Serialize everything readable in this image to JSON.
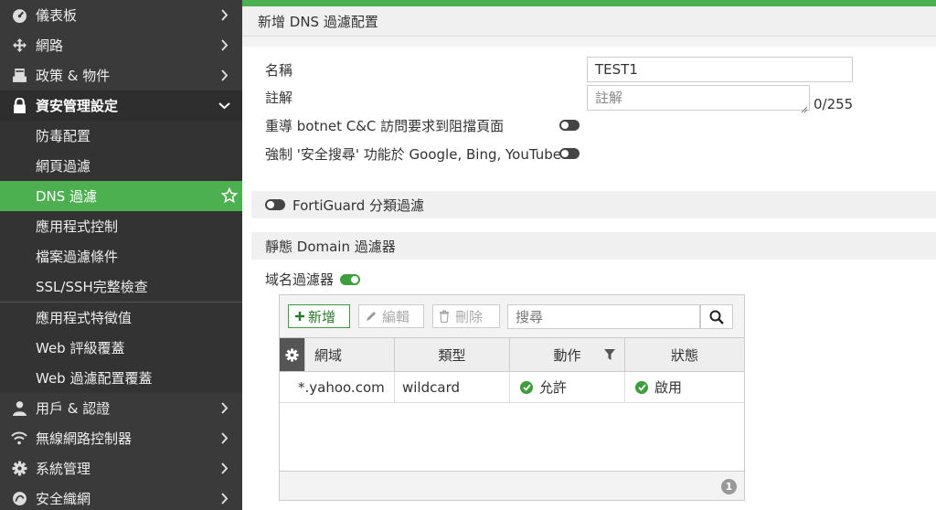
{
  "sidebar": {
    "items": [
      {
        "label": "儀表板",
        "icon": "dashboard-icon"
      },
      {
        "label": "網路",
        "icon": "network-icon"
      },
      {
        "label": "政策 & 物件",
        "icon": "policy-icon"
      },
      {
        "label": "資安管理設定",
        "icon": "lock-icon"
      },
      {
        "label": "防毒配置"
      },
      {
        "label": "網頁過濾"
      },
      {
        "label": "DNS 過濾"
      },
      {
        "label": "應用程式控制"
      },
      {
        "label": "檔案過濾條件"
      },
      {
        "label": "SSL/SSH完整檢查"
      },
      {
        "label": "應用程式特徵值"
      },
      {
        "label": "Web 評級覆蓋"
      },
      {
        "label": "Web 過濾配置覆蓋"
      },
      {
        "label": "用戶 & 認證",
        "icon": "user-icon"
      },
      {
        "label": "無線網路控制器",
        "icon": "wifi-icon"
      },
      {
        "label": "系統管理",
        "icon": "gear-icon"
      },
      {
        "label": "安全織網",
        "icon": "fabric-icon"
      }
    ]
  },
  "page": {
    "title": "新增 DNS 過濾配置"
  },
  "form": {
    "name_label": "名稱",
    "name_value": "TEST1",
    "comment_label": "註解",
    "comment_placeholder": "註解",
    "comment_counter": "0/255",
    "redirect_label": "重導 botnet C&C 訪問要求到阻擋頁面",
    "safesearch_label": "強制 '安全搜尋' 功能於 Google, Bing, YouTube"
  },
  "sections": {
    "fortiguard_label": "FortiGuard 分類過濾",
    "static_domain_label": "靜態 Domain 過濾器",
    "domain_filter_label": "域名過濾器"
  },
  "table": {
    "toolbar": {
      "add_label": "新增",
      "edit_label": "編輯",
      "delete_label": "刪除",
      "search_placeholder": "搜尋"
    },
    "columns": [
      "網域",
      "類型",
      "動作",
      "狀態"
    ],
    "rows": [
      {
        "domain": "*.yahoo.com",
        "type": "wildcard",
        "action": "允許",
        "status": "啟用"
      }
    ],
    "count": "1"
  },
  "colors": {
    "accent": "#4caf50",
    "sidebar_bg": "#3a3a3a",
    "toggle_on": "#3c9f3c"
  }
}
